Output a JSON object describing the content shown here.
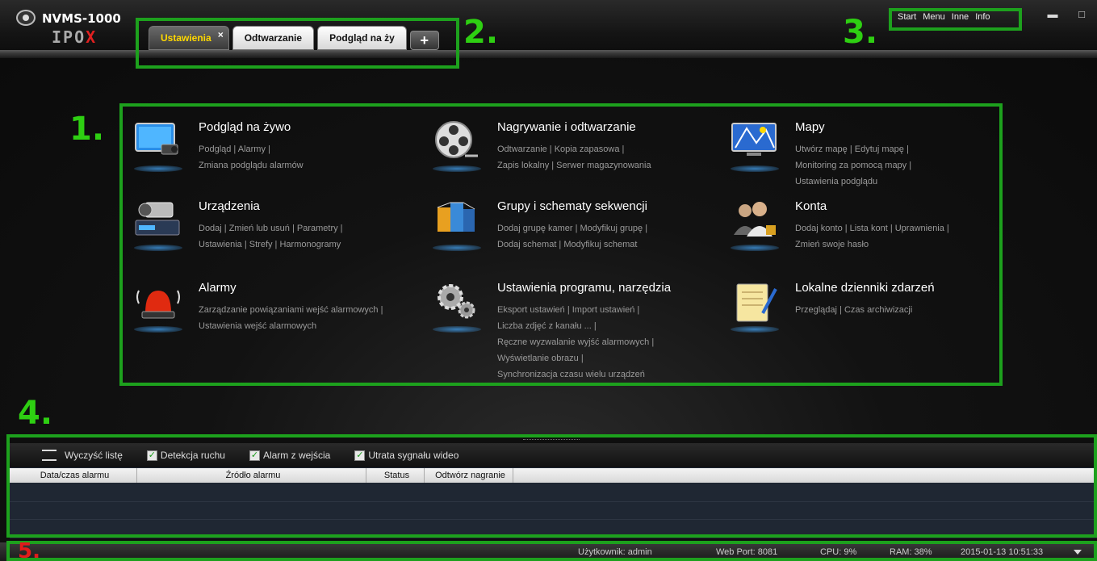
{
  "app": {
    "title": "NVMS-1000",
    "brand": "IPOX"
  },
  "tabs": [
    {
      "label": "Ustawienia",
      "close": "×"
    },
    {
      "label": "Odtwarzanie"
    },
    {
      "label": "Podgląd na ży"
    }
  ],
  "tab_add": "+",
  "top_menu": [
    "Start",
    "Menu",
    "Inne",
    "Info"
  ],
  "window_controls": {
    "minimize": "▬",
    "maximize": "□",
    "close": "✕"
  },
  "annotations": {
    "n1": "1.",
    "n2": "2.",
    "n3": "3.",
    "n4": "4.",
    "n5": "5."
  },
  "menu_items": [
    {
      "title": "Podgląd na żywo",
      "icon": "monitor-camera-icon",
      "lines": [
        "Podgląd  |  Alarmy  |",
        "Zmiana podglądu alarmów"
      ]
    },
    {
      "title": "Nagrywanie i odtwarzanie",
      "icon": "film-reel-icon",
      "lines": [
        "Odtwarzanie  |  Kopia zapasowa  |",
        "Zapis lokalny  |  Serwer magazynowania"
      ]
    },
    {
      "title": "Mapy",
      "icon": "map-icon",
      "lines": [
        "Utwórz mapę  |  Edytuj mapę  |",
        "Monitoring za pomocą mapy  |",
        "Ustawienia podglądu"
      ]
    },
    {
      "title": "Urządzenia",
      "icon": "camera-device-icon",
      "lines": [
        "Dodaj  |  Zmień lub usuń  |  Parametry  |",
        "Ustawienia  |  Strefy  |  Harmonogramy"
      ]
    },
    {
      "title": "Grupy i schematy sekwencji",
      "icon": "cubes-icon",
      "lines": [
        "Dodaj grupę kamer  |  Modyfikuj grupę  |",
        "Dodaj schemat  |  Modyfikuj schemat"
      ]
    },
    {
      "title": "Konta",
      "icon": "users-icon",
      "lines": [
        "Dodaj konto  |  Lista kont  |  Uprawnienia  |",
        "Zmień swoje hasło"
      ]
    },
    {
      "title": "Alarmy",
      "icon": "alarm-siren-icon",
      "lines": [
        "Zarządzanie powiązaniami wejść alarmowych  |",
        "Ustawienia wejść alarmowych"
      ]
    },
    {
      "title": "Ustawienia programu, narzędzia",
      "icon": "gears-icon",
      "lines": [
        "Eksport ustawień  |  Import ustawień  |",
        "Liczba zdjęć z kanału ...  |",
        "Ręczne wyzwalanie wyjść alarmowych  |",
        "Wyświetlanie obrazu  |",
        "Synchronizacja czasu wielu urządzeń"
      ]
    },
    {
      "title": "Lokalne dzienniki zdarzeń",
      "icon": "notepad-icon",
      "lines": [
        "Przeglądaj  |  Czas archiwizacji"
      ]
    }
  ],
  "alarm_toolbar": {
    "clear": "Wyczyść listę",
    "checks": [
      "Detekcja ruchu",
      "Alarm z wejścia",
      "Utrata sygnału wideo"
    ]
  },
  "alarm_table": {
    "columns": [
      "Data/czas alarmu",
      "Źródło alarmu",
      "Status",
      "Odtwórz nagranie"
    ]
  },
  "status": {
    "user": "Użytkownik: admin",
    "port": "Web Port: 8081",
    "cpu": "CPU: 9%",
    "ram": "RAM: 38%",
    "datetime": "2015-01-13 10:51:33"
  },
  "colors": {
    "annotation": "#1da11d",
    "annotation_text": "#2ecf12",
    "active_tab_text": "#ffd800"
  }
}
